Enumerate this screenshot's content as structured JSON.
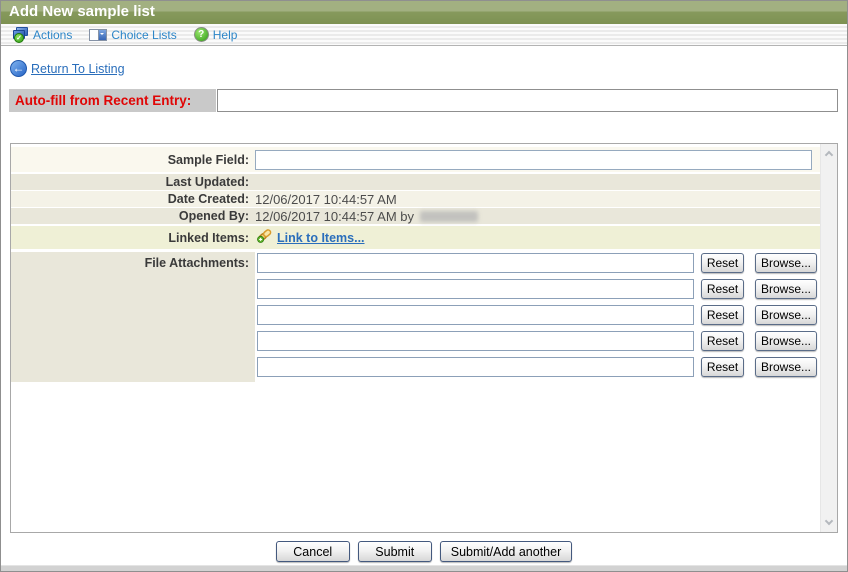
{
  "header": {
    "title": "Add New sample list"
  },
  "toolbar": {
    "actions_label": "Actions",
    "choice_lists_label": "Choice Lists",
    "help_label": "Help"
  },
  "nav": {
    "return_to_listing": "Return To Listing"
  },
  "autofill": {
    "label": "Auto-fill from Recent Entry:",
    "value": ""
  },
  "form": {
    "sample_field": {
      "label": "Sample Field:",
      "value": ""
    },
    "last_updated": {
      "label": "Last Updated:",
      "value": ""
    },
    "date_created": {
      "label": "Date Created:",
      "value": "12/06/2017 10:44:57 AM"
    },
    "opened_by": {
      "label": "Opened By:",
      "value": "12/06/2017 10:44:57 AM by",
      "name_redacted": true
    },
    "linked_items": {
      "label": "Linked Items:",
      "link_label": "Link to Items..."
    },
    "file_attachments": {
      "label": "File Attachments:",
      "row_count": 5,
      "reset_label": "Reset",
      "browse_label": "Browse...",
      "values": [
        "",
        "",
        "",
        "",
        ""
      ]
    }
  },
  "footer": {
    "cancel_label": "Cancel",
    "submit_label": "Submit",
    "submit_add_label": "Submit/Add another"
  },
  "icons": {
    "check_glyph": "✓",
    "help_glyph": "?",
    "arrow_left_glyph": "←"
  },
  "colors": {
    "header_green_top": "#a2b081",
    "header_green_bottom": "#7d9152",
    "toolbar_link_blue": "#2d86c8",
    "link_blue": "#2a6ebb",
    "autofill_label_red": "#e00505",
    "autofill_label_bg": "#c9c9c9",
    "row_light": "#faf8ee",
    "row_dark": "#e9e7da",
    "row_linked_items": "#eff0d6",
    "input_border": "#8ca0b8"
  }
}
